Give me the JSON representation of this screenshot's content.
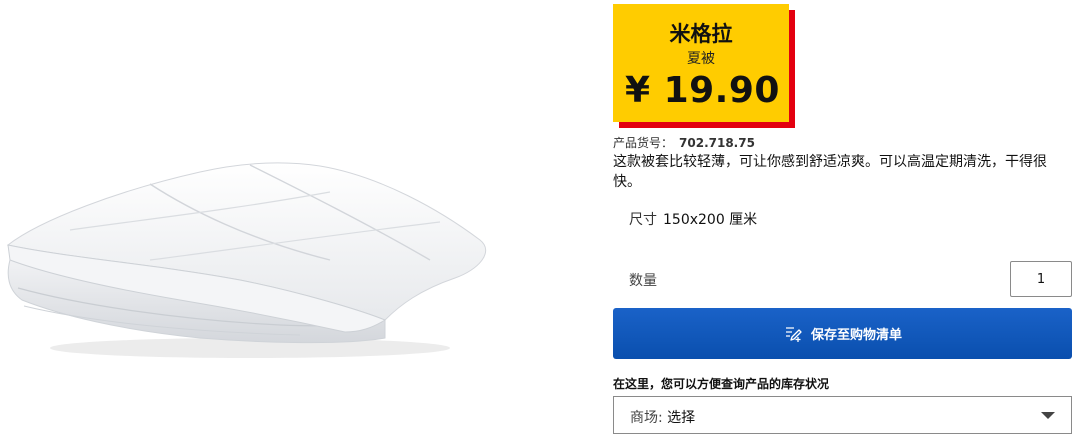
{
  "product": {
    "image_alt": "duvet",
    "name": "米格拉",
    "subtitle": "夏被",
    "price": "¥ 19.90",
    "article_label": "产品货号：",
    "article_number": "702.718.75",
    "description": "这款被套比较轻薄，可让你感到舒适凉爽。可以高温定期清洗，干得很快。",
    "size_label": "尺寸",
    "size_value": "150x200 厘米"
  },
  "quantity": {
    "label": "数量",
    "value": "1"
  },
  "save_button": {
    "label": "保存至购物清单",
    "icon": "edit-list-icon"
  },
  "stock": {
    "label": "在这里，您可以方便查询产品的库存状况",
    "store_prefix": "商场:",
    "store_value": "选择"
  },
  "colors": {
    "price_tag_bg": "#ffcc00",
    "price_tag_shadow": "#e3000f",
    "button_bg": "#0a4fae",
    "button_text": "#ffffff"
  }
}
